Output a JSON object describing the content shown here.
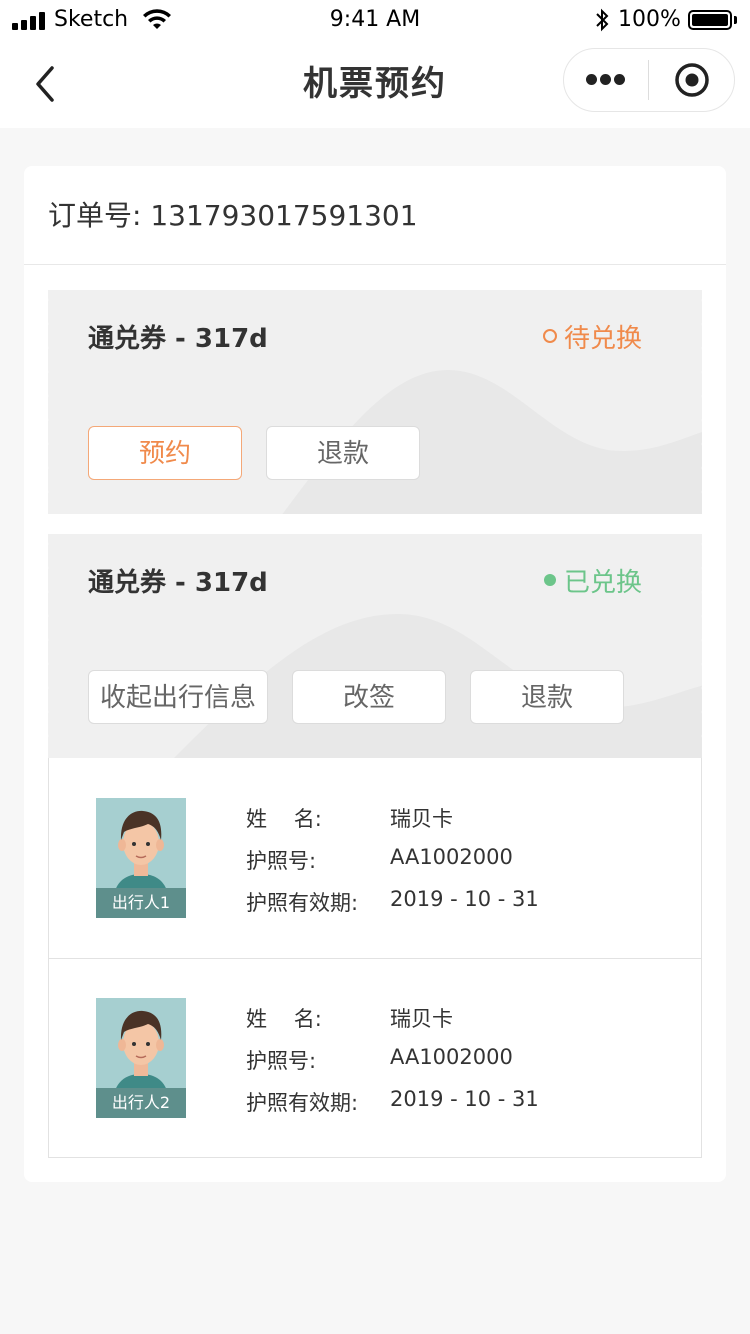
{
  "status_bar": {
    "carrier": "Sketch",
    "time": "9:41 AM",
    "battery": "100%"
  },
  "nav": {
    "title": "机票预约",
    "back_icon": "chevron-left-icon",
    "more_icon": "more-dots-icon",
    "close_icon": "target-circle-icon"
  },
  "order": {
    "text": "订单号: 131793017591301"
  },
  "tickets": [
    {
      "title": "通兑券 - 317d",
      "status": "待兑换",
      "status_color": "#f08a4b",
      "buttons": [
        "预约",
        "退款"
      ]
    },
    {
      "title": "通兑券 - 317d",
      "status": "已兑换",
      "status_color": "#6cc58a",
      "buttons": [
        "收起出行信息",
        "改签",
        "退款"
      ]
    }
  ],
  "travelers": [
    {
      "avatar_label": "出行人1",
      "name_label": "姓    名:",
      "name": "瑞贝卡",
      "passport_label": "护照号:",
      "passport": "AA1002000",
      "expiry_label": "护照有效期:",
      "expiry": "2019 - 10 - 31"
    },
    {
      "avatar_label": "出行人2",
      "name_label": "姓    名:",
      "name": "瑞贝卡",
      "passport_label": "护照号:",
      "passport": "AA1002000",
      "expiry_label": "护照有效期:",
      "expiry": "2019 - 10 - 31"
    }
  ]
}
